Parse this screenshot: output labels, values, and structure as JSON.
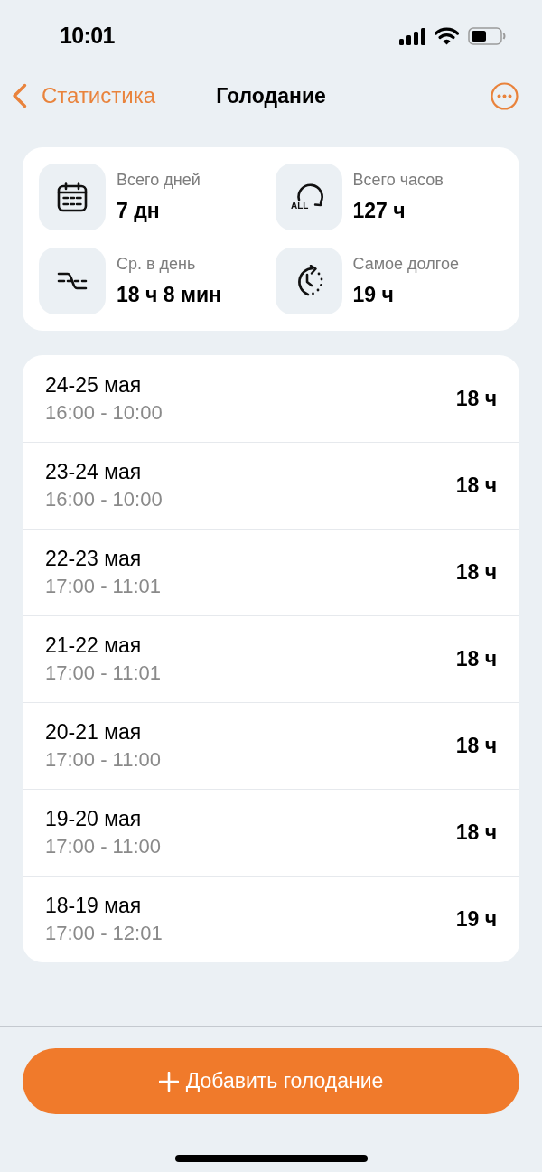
{
  "status_bar": {
    "time": "10:01"
  },
  "nav": {
    "back_label": "Статистика",
    "title": "Голодание"
  },
  "stats": [
    {
      "label": "Всего дней",
      "value": "7 дн"
    },
    {
      "label": "Всего часов",
      "value": "127 ч",
      "icon_text": "ALL"
    },
    {
      "label": "Ср. в день",
      "value": "18 ч 8 мин"
    },
    {
      "label": "Самое долгое",
      "value": "19 ч"
    }
  ],
  "fasts": [
    {
      "dates": "24-25 мая",
      "times": "16:00 - 10:00",
      "duration": "18 ч"
    },
    {
      "dates": "23-24 мая",
      "times": "16:00 - 10:00",
      "duration": "18 ч"
    },
    {
      "dates": "22-23 мая",
      "times": "17:00 - 11:01",
      "duration": "18 ч"
    },
    {
      "dates": "21-22 мая",
      "times": "17:00 - 11:01",
      "duration": "18 ч"
    },
    {
      "dates": "20-21 мая",
      "times": "17:00 - 11:00",
      "duration": "18 ч"
    },
    {
      "dates": "19-20 мая",
      "times": "17:00 - 11:00",
      "duration": "18 ч"
    },
    {
      "dates": "18-19 мая",
      "times": "17:00 - 12:01",
      "duration": "19 ч"
    }
  ],
  "add_button": {
    "label": "Добавить голодание"
  }
}
